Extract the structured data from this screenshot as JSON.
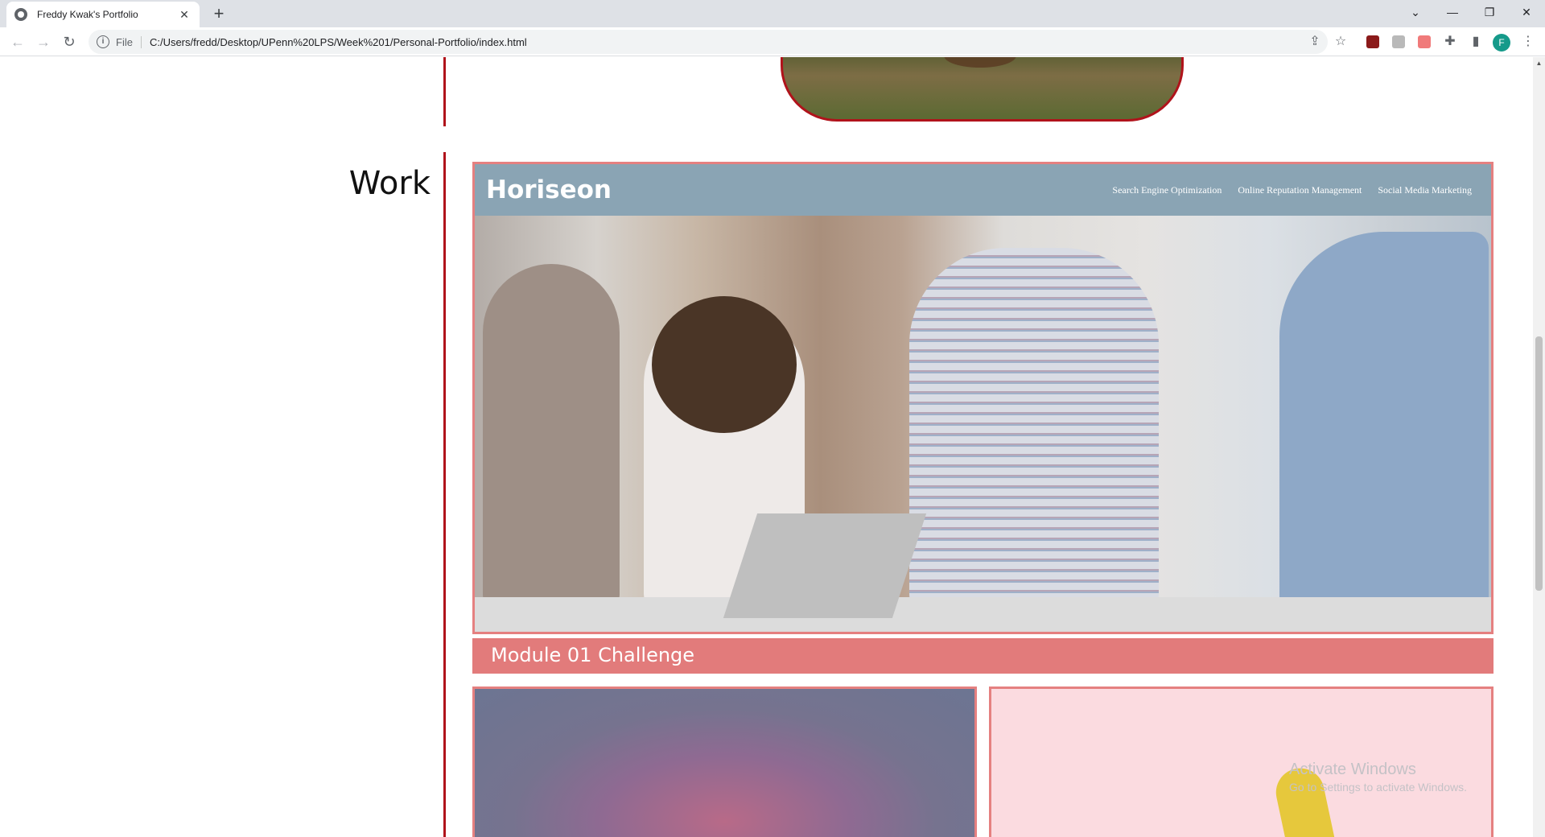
{
  "browser": {
    "tab_title": "Freddy Kwak's Portfolio",
    "tab_close": "✕",
    "new_tab": "+",
    "scheme_label": "File",
    "url": "C:/Users/fredd/Desktop/UPenn%20LPS/Week%201/Personal-Portfolio/index.html",
    "profile_initial": "F",
    "window_controls": {
      "tab_search": "⌄",
      "minimize": "—",
      "restore": "❐",
      "close": "✕"
    }
  },
  "page": {
    "work_heading": "Work",
    "horiseon": {
      "logo": "Horiseon",
      "nav": [
        "Search Engine Optimization",
        "Online Reputation Management",
        "Social Media Marketing"
      ]
    },
    "main_caption": "Module 01 Challenge"
  },
  "overlay": {
    "activate_title": "Activate Windows",
    "activate_subtitle": "Go to Settings to activate Windows."
  },
  "colors": {
    "divider": "#b0131b",
    "card_border": "#e58080",
    "caption_bg": "#e27b7b",
    "horiseon_header": "#8aa4b4"
  }
}
